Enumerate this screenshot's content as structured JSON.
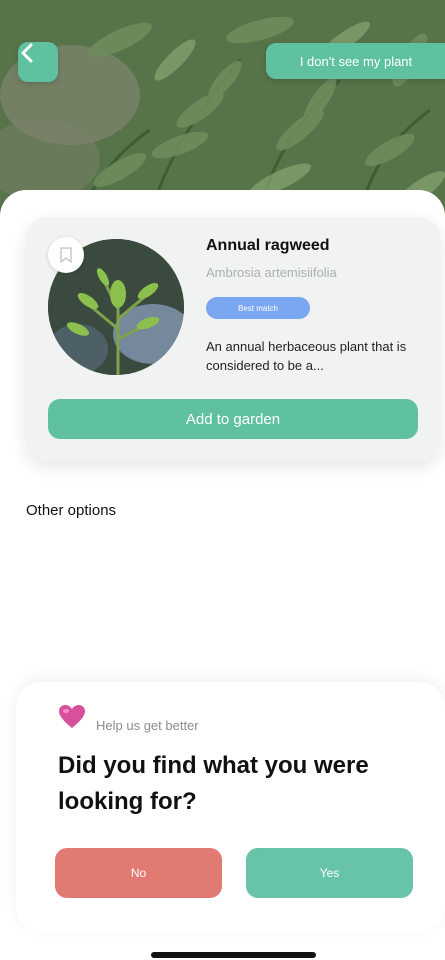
{
  "header": {
    "back_icon": "chevron-left-icon",
    "no_plant_label": "I don't see my plant"
  },
  "best_match": {
    "name": "Annual ragweed",
    "scientific_name": "Ambrosia artemisiifolia",
    "badge": "Best match",
    "description": "An annual herbaceous plant that is considered to be a...",
    "bookmark_icon": "bookmark-icon",
    "add_label": "Add to garden"
  },
  "other_options": {
    "title": "Other options"
  },
  "feedback": {
    "icon": "heart-icon",
    "help_text": "Help us get better",
    "question": "Did you find what you were looking for?",
    "no_label": "No",
    "yes_label": "Yes"
  },
  "colors": {
    "accent": "#5fc1a0",
    "badge": "#7aa6f2",
    "no": "#e17a73",
    "yes": "#67c4a8",
    "card_bg": "#f1f2f2"
  }
}
